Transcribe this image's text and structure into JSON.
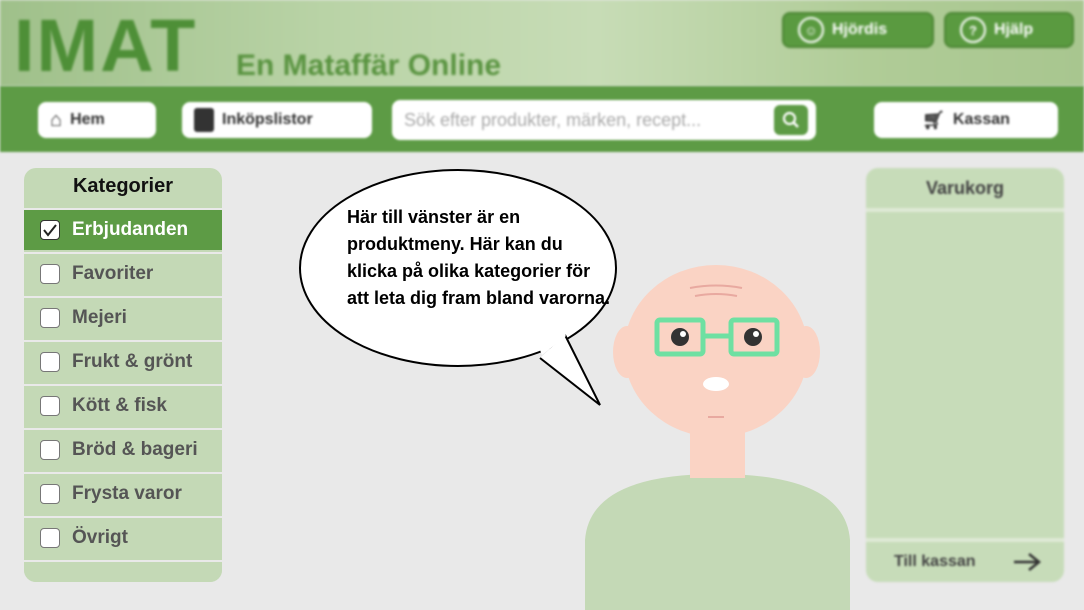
{
  "header": {
    "logo": "IMAT",
    "tagline": "En Mataffär Online",
    "user_label": "Hjördis",
    "help_label": "Hjälp"
  },
  "nav": {
    "home_label": "Hem",
    "lists_label": "Inköpslistor",
    "search_placeholder": "Sök efter produkter, märken, recept...",
    "checkout_label": "Kassan"
  },
  "sidebar": {
    "title": "Kategorier",
    "items": [
      {
        "label": "Erbjudanden",
        "checked": true
      },
      {
        "label": "Favoriter",
        "checked": false
      },
      {
        "label": "Mejeri",
        "checked": false
      },
      {
        "label": "Frukt & grönt",
        "checked": false
      },
      {
        "label": "Kött & fisk",
        "checked": false
      },
      {
        "label": "Bröd & bageri",
        "checked": false
      },
      {
        "label": "Frysta varor",
        "checked": false
      },
      {
        "label": "Övrigt",
        "checked": false
      }
    ]
  },
  "cart": {
    "title": "Varukorg",
    "checkout_label": "Till kassan"
  },
  "bubble": {
    "text": "Här till vänster är en produktmeny. Här kan du klicka på olika kategorier för att leta dig fram bland varorna."
  },
  "colors": {
    "brand_green": "#5d9b45",
    "light_green": "#c4d9b6",
    "skin": "#fad3c4",
    "glasses": "#6ee0a2"
  }
}
